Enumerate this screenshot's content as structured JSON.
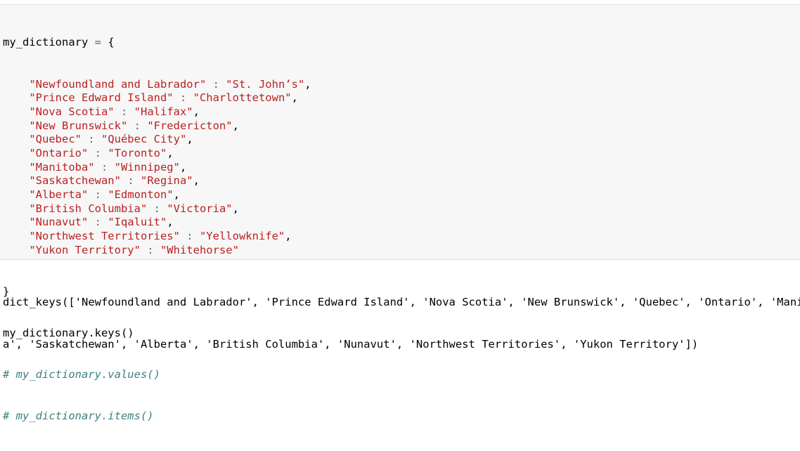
{
  "cell": {
    "var_name": "my_dictionary",
    "assign": " = ",
    "open_brace": "{",
    "close_brace": "}",
    "indent": "    ",
    "kv_sep": " : ",
    "comma": ",",
    "entries": [
      {
        "key": "\"Newfoundland and Labrador\"",
        "value": "\"St. John’s\""
      },
      {
        "key": "\"Prince Edward Island\"",
        "value": "\"Charlottetown\""
      },
      {
        "key": "\"Nova Scotia\"",
        "value": "\"Halifax\""
      },
      {
        "key": "\"New Brunswick\"",
        "value": "\"Fredericton\""
      },
      {
        "key": "\"Quebec\"",
        "value": "\"Québec City\""
      },
      {
        "key": "\"Ontario\"",
        "value": "\"Toronto\""
      },
      {
        "key": "\"Manitoba\"",
        "value": "\"Winnipeg\""
      },
      {
        "key": "\"Saskatchewan\"",
        "value": "\"Regina\""
      },
      {
        "key": "\"Alberta\"",
        "value": "\"Edmonton\""
      },
      {
        "key": "\"British Columbia\"",
        "value": "\"Victoria\""
      },
      {
        "key": "\"Nunavut\"",
        "value": "\"Iqaluit\""
      },
      {
        "key": "\"Northwest Territories\"",
        "value": "\"Yellowknife\""
      },
      {
        "key": "\"Yukon Territory\"",
        "value": "\"Whitehorse\""
      }
    ],
    "call_line": "my_dictionary.keys()",
    "comment_lines": [
      "# my_dictionary.values()",
      "# my_dictionary.items()"
    ]
  },
  "output": {
    "lines": [
      "dict_keys(['Newfoundland and Labrador', 'Prince Edward Island', 'Nova Scotia', 'New Brunswick', 'Quebec', 'Ontario', 'Manitob",
      "a', 'Saskatchewan', 'Alberta', 'British Columbia', 'Nunavut', 'Northwest Territories', 'Yukon Territory'])"
    ]
  },
  "colors": {
    "string": "#ba2121",
    "operator": "#666666",
    "comment": "#408080",
    "cell_background": "#f7f7f7"
  }
}
